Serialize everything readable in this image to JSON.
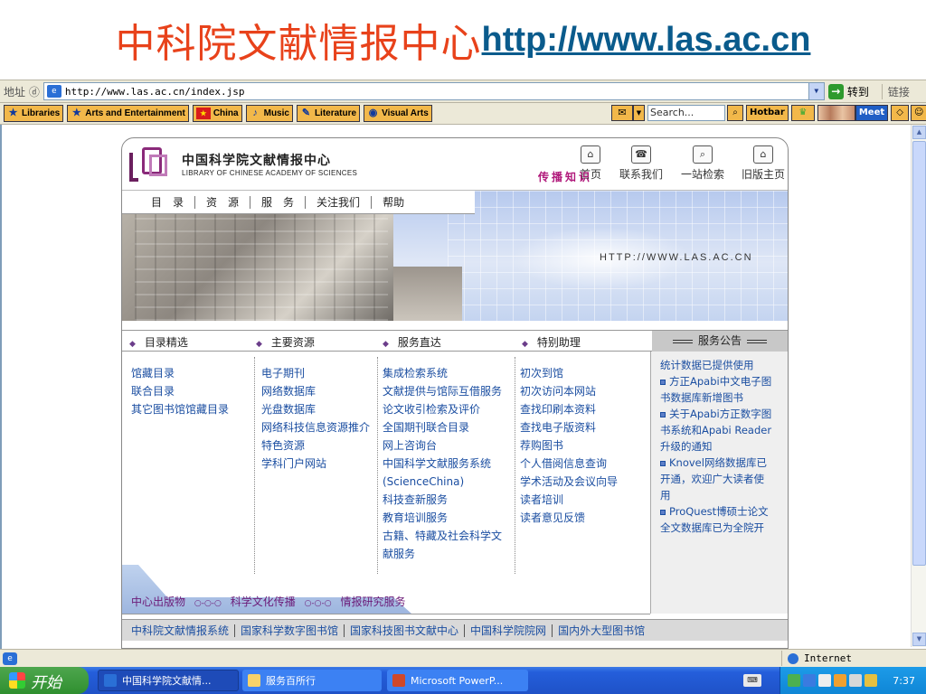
{
  "slide": {
    "title_cn": "中科院文献情报中心",
    "title_url": "http://www.las.ac.cn"
  },
  "browser": {
    "address_label": "地址 ⓓ",
    "address_value": "http://www.las.ac.cn/index.jsp",
    "go_label": "转到",
    "links_label": "链接",
    "links": [
      "Libraries",
      "Arts and Entertainment",
      "China",
      "Music",
      "Literature",
      "Visual Arts"
    ],
    "search_placeholder": "Search...",
    "hotbar_label": "Hotbar",
    "meet_label": "Meet",
    "status_zone": "Internet"
  },
  "site": {
    "org_name_cn": "中国科学院文献情报中心",
    "org_name_en": "LIBRARY OF CHINESE ACADEMY OF SCIENCES",
    "top_nav": [
      "首页",
      "联系我们",
      "一站检索",
      "旧版主页"
    ],
    "menu": [
      "目　录",
      "资　源",
      "服　务",
      "关注我们",
      "帮助"
    ],
    "slogan": "传播知识",
    "banner_url": "HTTP://WWW.LAS.AC.CN",
    "categories": [
      "目录精选",
      "主要资源",
      "服务直达",
      "特别助理"
    ],
    "notice_title": "服务公告",
    "col1": [
      "馆藏目录",
      "联合目录",
      "其它图书馆馆藏目录"
    ],
    "col2": [
      "电子期刊",
      "网络数据库",
      "光盘数据库",
      "网络科技信息资源推介",
      "特色资源",
      "学科门户网站"
    ],
    "col3": [
      "集成检索系统",
      "文献提供与馆际互借服务",
      "论文收引检索及评价",
      "全国期刊联合目录",
      "网上咨询台",
      "中国科学文献服务系统",
      "(ScienceChina)",
      "科技查新服务",
      "教育培训服务",
      "古籍、特藏及社会科学文",
      "献服务"
    ],
    "col4": [
      "初次到馆",
      "初次访问本网站",
      "查找印刷本资料",
      "查找电子版资料",
      "荐购图书",
      "个人借阅信息查询",
      "学术活动及会议向导",
      "读者培训",
      "读者意见反馈"
    ],
    "notices": {
      "n0": "统计数据已提供使用",
      "n1a": "方正Apabi中文电子图",
      "n1b": "书数据库新增图书",
      "n2a": "关于Apabi方正数字图",
      "n2b": "书系统和Apabi Reader",
      "n2c": "升级的通知",
      "n3a": "Knovel网络数据库已",
      "n3b": "开通，欢迎广大读者使",
      "n3c": "用",
      "n4a": "ProQuest博硕士论文",
      "n4b": "全文数据库已为全院开"
    },
    "pub_links": [
      "中心出版物",
      "科学文化传播",
      "情报研究服务"
    ],
    "pub_sep": "○-○-○",
    "bottom_links": [
      "中科院文献情报系统",
      "国家科学数字图书馆",
      "国家科技图书文献中心",
      "中国科学院院网",
      "国内外大型图书馆"
    ]
  },
  "taskbar": {
    "start_label": "开始",
    "tasks": [
      "中国科学院文献情...",
      "服务百所行",
      "Microsoft PowerP..."
    ],
    "clock": "7:37"
  }
}
